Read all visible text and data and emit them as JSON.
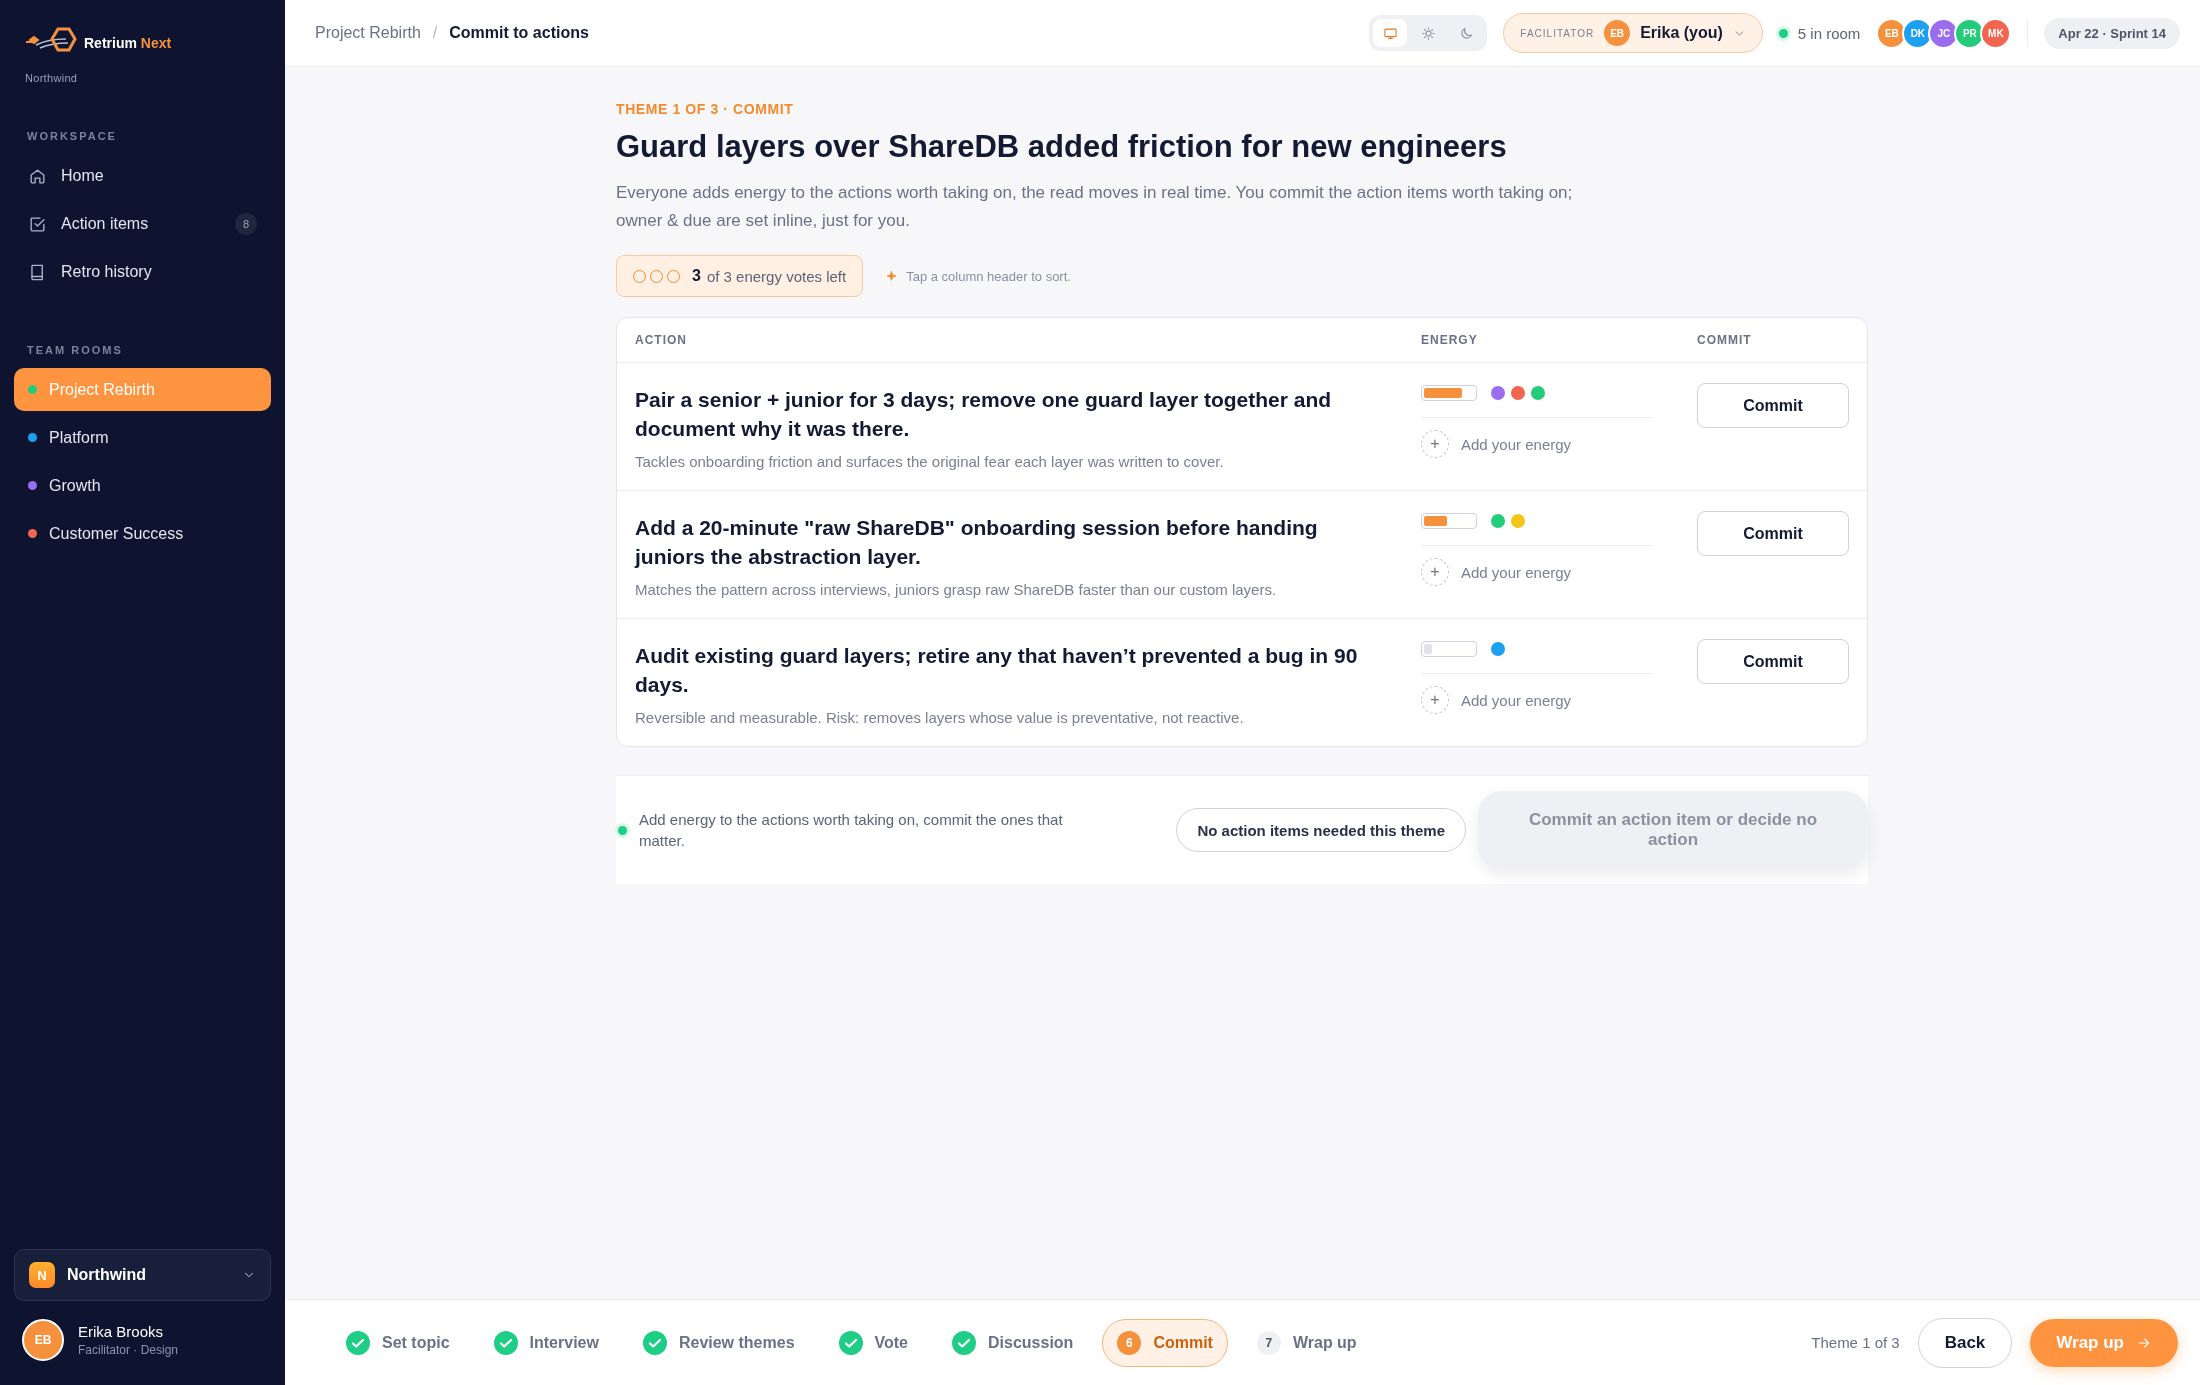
{
  "sidebar": {
    "logo": {
      "name": "Retrium",
      "accent": "Next"
    },
    "org": "Northwind",
    "sections": [
      {
        "title": "WORKSPACE",
        "items": [
          {
            "kind": "home",
            "label": "Home",
            "selected": false
          },
          {
            "kind": "check",
            "label": "Action items",
            "badge": "8",
            "selected": false
          },
          {
            "kind": "book",
            "label": "Retro history",
            "selected": false
          }
        ]
      },
      {
        "title": "TEAM ROOMS",
        "items": [
          {
            "kind": "room",
            "label": "Project Rebirth",
            "color": "#22cc7a",
            "selected": true
          },
          {
            "kind": "room",
            "label": "Platform",
            "color": "#1ea0f0",
            "selected": false
          },
          {
            "kind": "room",
            "label": "Growth",
            "color": "#9a6cf0",
            "selected": false
          },
          {
            "kind": "room",
            "label": "Customer Success",
            "color": "#f2654f",
            "selected": false
          }
        ]
      }
    ],
    "org_switcher": {
      "initial": "N",
      "name": "Northwind"
    },
    "user": {
      "initials": "EB",
      "name": "Erika Brooks",
      "role": "Facilitator · Design"
    }
  },
  "topbar": {
    "breadcrumb_separator": "/",
    "breadcrumb": [
      {
        "label": "Project Rebirth",
        "current": false
      },
      {
        "label": "Commit to actions",
        "current": true
      }
    ],
    "display_modes": [
      {
        "kind": "screen",
        "selected": true
      },
      {
        "kind": "sun",
        "selected": false
      },
      {
        "kind": "moon",
        "selected": false
      }
    ],
    "facilitator": {
      "label": "FACILITATOR",
      "initials": "EB",
      "name": "Erika (you)"
    },
    "presence": "5 in room",
    "participants": [
      {
        "initials": "EB",
        "color": "#f5913d"
      },
      {
        "initials": "DK",
        "color": "#1ea0f0"
      },
      {
        "initials": "JC",
        "color": "#9a6cf0"
      },
      {
        "initials": "PR",
        "color": "#22cc7a"
      },
      {
        "initials": "MK",
        "color": "#f2654f"
      }
    ],
    "sprint": "Apr 22 · Sprint 14"
  },
  "header": {
    "eyebrow": "THEME 1 OF 3 · COMMIT",
    "title": "Guard layers over ShareDB added friction for new engineers",
    "description": "Everyone adds energy to the actions worth taking on, the read moves in real time. You commit the action items worth taking on; owner & due are set inline, just for you."
  },
  "votes": {
    "dots": [
      {
        "used": false
      },
      {
        "used": false
      },
      {
        "used": false
      }
    ],
    "count": "3",
    "text": "of 3 energy votes left"
  },
  "hint": "Tap a column header to sort.",
  "table": {
    "columns": [
      "ACTION",
      "ENERGY",
      "COMMIT"
    ],
    "rows": [
      {
        "title": "Pair a senior + junior for 3 days; remove one guard layer together and document why it was there.",
        "note": "Tackles onboarding friction and surfaces the original fear each layer was written to cover.",
        "level": 0.75,
        "voters": [
          {
            "color": "#9a6cf0"
          },
          {
            "color": "#f2654f"
          },
          {
            "color": "#22cc7a"
          }
        ],
        "add": "Add your energy",
        "add_icon": "+",
        "button": "Commit"
      },
      {
        "title": "Add a 20-minute \"raw ShareDB\" onboarding session before handing juniors the abstraction layer.",
        "note": "Matches the pattern across interviews, juniors grasp raw ShareDB faster than our custom layers.",
        "level": 0.45,
        "voters": [
          {
            "color": "#22cc7a"
          },
          {
            "color": "#f5c518"
          }
        ],
        "add": "Add your energy",
        "add_icon": "+",
        "button": "Commit"
      },
      {
        "title": "Audit existing guard layers; retire any that haven’t prevented a bug in 90 days.",
        "note": "Reversible and measurable. Risk: removes layers whose value is preventative, not reactive.",
        "level": 0.15,
        "voters": [
          {
            "color": "#1ea0f0"
          }
        ],
        "add": "Add your energy",
        "add_icon": "+",
        "button": "Commit"
      }
    ]
  },
  "footer": {
    "status": "Add energy to the actions worth taking on, commit the ones that matter.",
    "secondary": "No action items needed this theme",
    "primary": {
      "label": "Commit an action item or decide no action",
      "disabled": true
    }
  },
  "stepper": {
    "steps": [
      {
        "label": "Set topic",
        "done": true,
        "selected": false
      },
      {
        "label": "Interview",
        "done": true,
        "selected": false
      },
      {
        "label": "Review themes",
        "done": true,
        "selected": false
      },
      {
        "label": "Vote",
        "done": true,
        "selected": false
      },
      {
        "label": "Discussion",
        "done": true,
        "selected": false
      },
      {
        "number": "6",
        "label": "Commit",
        "done": false,
        "selected": true
      },
      {
        "number": "7",
        "label": "Wrap up",
        "done": false,
        "selected": false
      }
    ],
    "progress": "Theme 1 of 3",
    "back": "Back",
    "next": "Wrap up"
  }
}
